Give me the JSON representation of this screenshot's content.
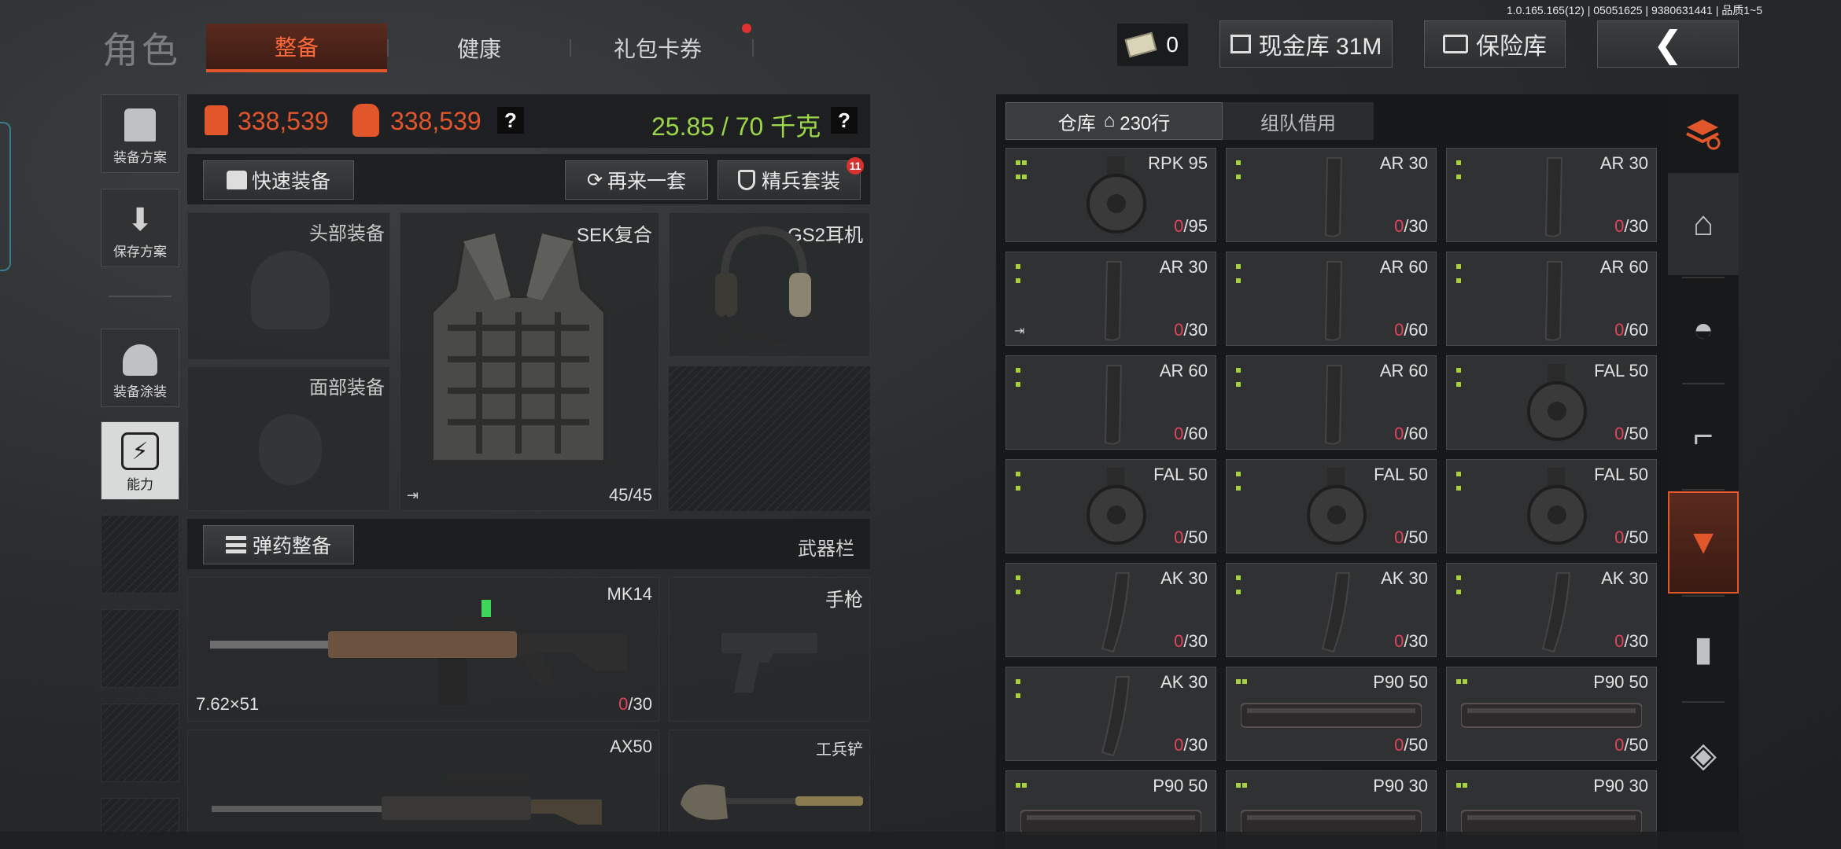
{
  "version": "1.0.165.165(12) | 05051625 | 9380631441 | 品质1~5",
  "header": {
    "title": "角色",
    "tabs": [
      {
        "label": "整备",
        "active": true
      },
      {
        "label": "健康",
        "active": false
      },
      {
        "label": "礼包卡券",
        "active": false,
        "badge": true
      }
    ],
    "cash_value": "0",
    "cash_vault_label": "现金库 31M",
    "safe_label": "保险库"
  },
  "left_tools": [
    {
      "label": "装备方案",
      "icon": "vest-plan-icon"
    },
    {
      "label": "保存方案",
      "icon": "download-icon"
    },
    {
      "label": "装备涂装",
      "icon": "helmet-paint-icon"
    },
    {
      "label": "能力",
      "icon": "ability-icon"
    }
  ],
  "stats": {
    "armor_value": "338,539",
    "backpack_value": "338,539",
    "weight": "25.85 / 70 千克",
    "help": "?"
  },
  "actions": {
    "quick_equip": "快速装备",
    "again": "再来一套",
    "elite": "精兵套装",
    "elite_badge": "11"
  },
  "gear": {
    "head": "头部装备",
    "face": "面部装备",
    "body_name": "SEK复合",
    "body_durability": "45/45",
    "headset": "GS2耳机"
  },
  "weapons_bar": {
    "ammo_button": "弹药整备",
    "label": "武器栏",
    "primary": {
      "name": "MK14",
      "caliber": "7.62×51",
      "ammo_zero": "0",
      "ammo_max": "/30"
    },
    "pistol": "手枪",
    "secondary": {
      "name": "AX50"
    },
    "melee": "工兵铲"
  },
  "storage": {
    "tab_warehouse": "仓库",
    "rows": "230行",
    "tab_team": "组队借用",
    "items": [
      {
        "name": "RPK 95",
        "zero": "0",
        "max": "/95",
        "kind": "drum",
        "dots": 4
      },
      {
        "name": "AR 30",
        "zero": "0",
        "max": "/30",
        "kind": "mag",
        "dots": 2
      },
      {
        "name": "AR 30",
        "zero": "0",
        "max": "/30",
        "kind": "mag",
        "dots": 2
      },
      {
        "name": "AR 30",
        "zero": "0",
        "max": "/30",
        "kind": "mag",
        "dots": 2
      },
      {
        "name": "AR 60",
        "zero": "0",
        "max": "/60",
        "kind": "mag",
        "dots": 2
      },
      {
        "name": "AR 60",
        "zero": "0",
        "max": "/60",
        "kind": "mag",
        "dots": 2
      },
      {
        "name": "AR 60",
        "zero": "0",
        "max": "/60",
        "kind": "mag",
        "dots": 2
      },
      {
        "name": "AR 60",
        "zero": "0",
        "max": "/60",
        "kind": "mag",
        "dots": 2
      },
      {
        "name": "FAL 50",
        "zero": "0",
        "max": "/50",
        "kind": "drum",
        "dots": 2
      },
      {
        "name": "FAL 50",
        "zero": "0",
        "max": "/50",
        "kind": "drum",
        "dots": 2
      },
      {
        "name": "FAL 50",
        "zero": "0",
        "max": "/50",
        "kind": "drum",
        "dots": 2
      },
      {
        "name": "FAL 50",
        "zero": "0",
        "max": "/50",
        "kind": "drum",
        "dots": 2
      },
      {
        "name": "AK 30",
        "zero": "0",
        "max": "/30",
        "kind": "curve",
        "dots": 2
      },
      {
        "name": "AK 30",
        "zero": "0",
        "max": "/30",
        "kind": "curve",
        "dots": 2
      },
      {
        "name": "AK 30",
        "zero": "0",
        "max": "/30",
        "kind": "curve",
        "dots": 2
      },
      {
        "name": "AK 30",
        "zero": "0",
        "max": "/30",
        "kind": "curve",
        "dots": 2
      },
      {
        "name": "P90 50",
        "zero": "0",
        "max": "/50",
        "kind": "flat",
        "dots": 22
      },
      {
        "name": "P90 50",
        "zero": "0",
        "max": "/50",
        "kind": "flat",
        "dots": 22
      },
      {
        "name": "P90 50",
        "zero": "",
        "max": "",
        "kind": "flat",
        "dots": 22
      },
      {
        "name": "P90 30",
        "zero": "",
        "max": "",
        "kind": "flat",
        "dots": 22
      },
      {
        "name": "P90 30",
        "zero": "",
        "max": "",
        "kind": "flat",
        "dots": 22
      }
    ]
  },
  "side_categories": [
    {
      "icon": "home-icon",
      "active": false
    },
    {
      "icon": "helmet-icon",
      "active": false
    },
    {
      "icon": "rifle-icon",
      "active": false
    },
    {
      "icon": "ammo-box-icon",
      "active": true
    },
    {
      "icon": "bullet-icon",
      "active": false
    },
    {
      "icon": "scope-icon",
      "active": false
    }
  ],
  "colors": {
    "accent_orange": "#e2562c",
    "weight_green": "#9bd64a",
    "ammo_red": "#e4425c",
    "dot_green": "#a7d23c"
  }
}
